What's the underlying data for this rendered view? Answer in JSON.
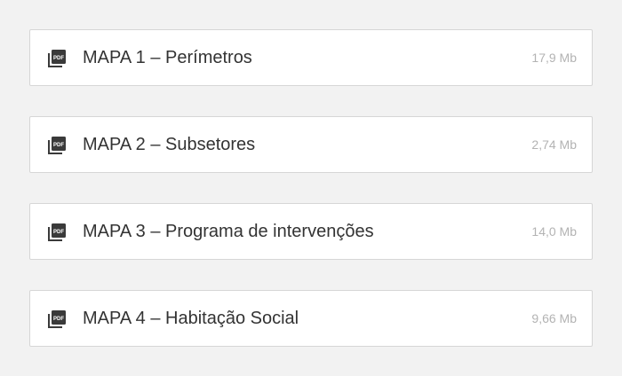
{
  "files": [
    {
      "icon": "pdf-file-icon",
      "name": "MAPA 1 – Perímetros",
      "size": "17,9 Mb"
    },
    {
      "icon": "pdf-file-icon",
      "name": "MAPA 2 – Subsetores",
      "size": "2,74 Mb"
    },
    {
      "icon": "pdf-file-icon",
      "name": "MAPA 3 – Programa de intervenções",
      "size": "14,0 Mb"
    },
    {
      "icon": "pdf-file-icon",
      "name": "MAPA 4 – Habitação Social",
      "size": "9,66 Mb"
    }
  ],
  "colors": {
    "background": "#f2f2f2",
    "card": "#ffffff",
    "border": "#d6d6d6",
    "text": "#333333",
    "muted": "#b3b3b3",
    "icon": "#3a3a3a"
  }
}
